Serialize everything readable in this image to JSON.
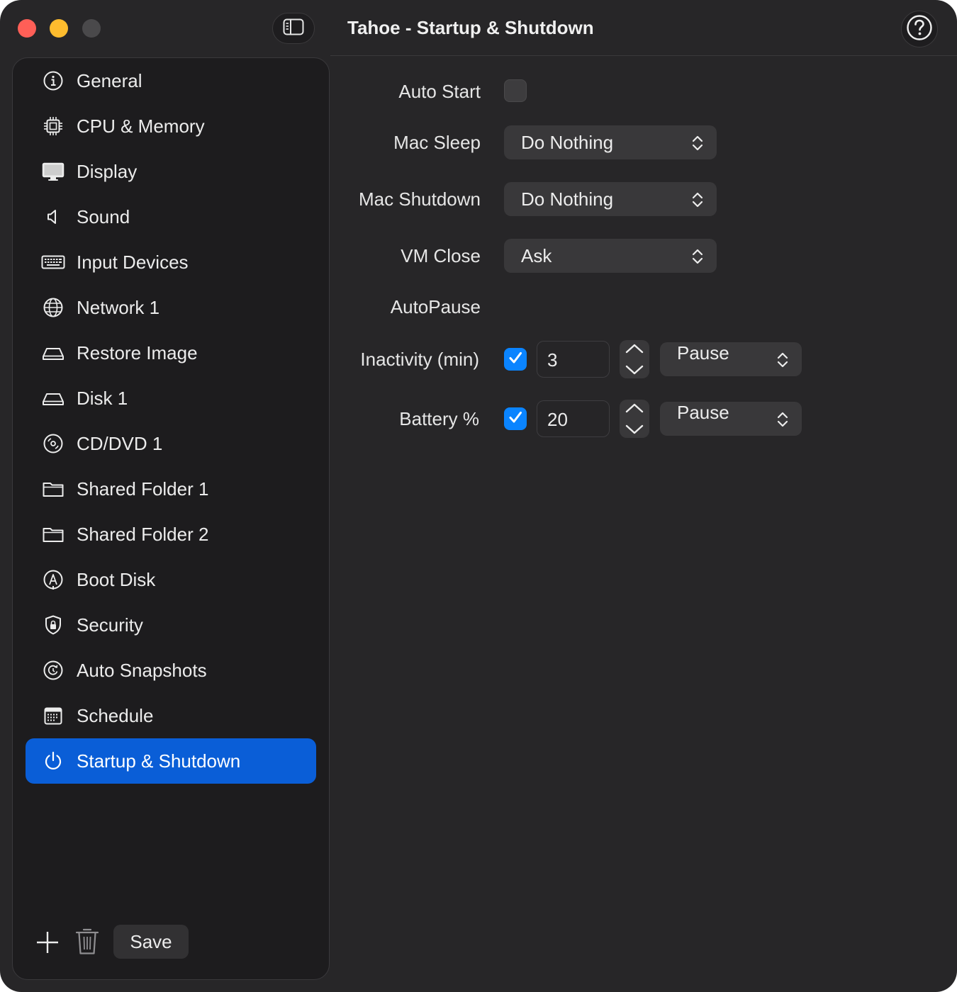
{
  "window": {
    "title": "Tahoe - Startup & Shutdown"
  },
  "sidebar": {
    "items": [
      {
        "label": "General",
        "icon": "info-circle-icon"
      },
      {
        "label": "CPU & Memory",
        "icon": "cpu-chip-icon"
      },
      {
        "label": "Display",
        "icon": "display-icon"
      },
      {
        "label": "Sound",
        "icon": "speaker-icon"
      },
      {
        "label": "Input Devices",
        "icon": "keyboard-icon"
      },
      {
        "label": "Network 1",
        "icon": "globe-icon"
      },
      {
        "label": "Restore Image",
        "icon": "drive-icon"
      },
      {
        "label": "Disk 1",
        "icon": "drive-icon"
      },
      {
        "label": "CD/DVD 1",
        "icon": "disc-icon"
      },
      {
        "label": "Shared Folder 1",
        "icon": "folder-icon"
      },
      {
        "label": "Shared Folder 2",
        "icon": "folder-icon"
      },
      {
        "label": "Boot Disk",
        "icon": "boot-disk-icon"
      },
      {
        "label": "Security",
        "icon": "shield-lock-icon"
      },
      {
        "label": "Auto Snapshots",
        "icon": "snapshot-clock-icon"
      },
      {
        "label": "Schedule",
        "icon": "calendar-icon"
      },
      {
        "label": "Startup & Shutdown",
        "icon": "power-icon"
      }
    ],
    "selected_index": 15,
    "save_label": "Save"
  },
  "form": {
    "auto_start": {
      "label": "Auto Start",
      "checked": false
    },
    "mac_sleep": {
      "label": "Mac Sleep",
      "value": "Do Nothing"
    },
    "mac_shutdown": {
      "label": "Mac Shutdown",
      "value": "Do Nothing"
    },
    "vm_close": {
      "label": "VM Close",
      "value": "Ask"
    },
    "autopause": {
      "label": "AutoPause"
    },
    "inactivity": {
      "label": "Inactivity (min)",
      "checked": true,
      "value": "3",
      "action": "Pause"
    },
    "battery": {
      "label": "Battery %",
      "checked": true,
      "value": "20",
      "action": "Pause"
    }
  },
  "colors": {
    "accent": "#0a5ed7",
    "checkbox_on": "#0a84ff",
    "window_bg": "#272628",
    "sidebar_bg": "#1d1c1e"
  }
}
